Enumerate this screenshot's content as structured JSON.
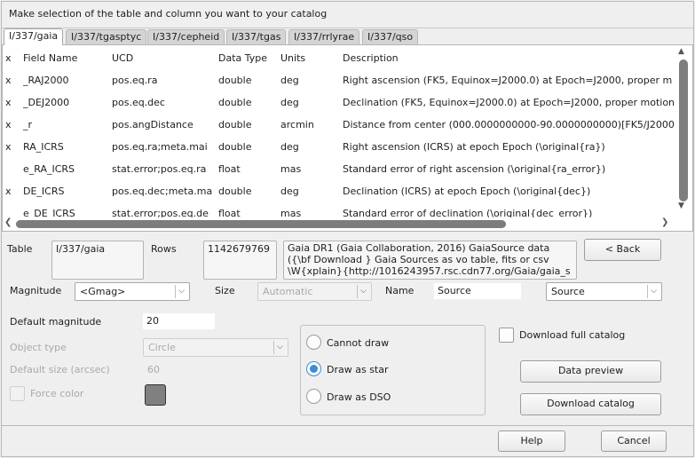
{
  "header": "Make selection of the table and column you want to your catalog",
  "tabs": [
    "I/337/gaia",
    "I/337/tgasptyc",
    "I/337/cepheid",
    "I/337/tgas",
    "I/337/rrlyrae",
    "I/337/qso"
  ],
  "table": {
    "columns": [
      "x",
      "Field Name",
      "UCD",
      "Data Type",
      "Units",
      "Description"
    ],
    "rows": [
      {
        "x": "x",
        "name": "_RAJ2000",
        "ucd": "pos.eq.ra",
        "type": "double",
        "units": "deg",
        "desc": "Right ascension (FK5, Equinox=J2000.0) at Epoch=J2000, proper m"
      },
      {
        "x": "x",
        "name": "_DEJ2000",
        "ucd": "pos.eq.dec",
        "type": "double",
        "units": "deg",
        "desc": "Declination (FK5, Equinox=J2000.0) at Epoch=J2000, proper motion"
      },
      {
        "x": "x",
        "name": "_r",
        "ucd": "pos.angDistance",
        "type": "double",
        "units": "arcmin",
        "desc": "Distance from center (000.0000000000-90.0000000000)[FK5/J2000"
      },
      {
        "x": "x",
        "name": "RA_ICRS",
        "ucd": "pos.eq.ra;meta.mai",
        "type": "double",
        "units": "deg",
        "desc": "Right ascension (ICRS) at epoch Epoch (\\original{ra})"
      },
      {
        "x": "",
        "name": "e_RA_ICRS",
        "ucd": "stat.error;pos.eq.ra",
        "type": "float",
        "units": "mas",
        "desc": "Standard error of right ascension (\\original{ra_error})"
      },
      {
        "x": "x",
        "name": "DE_ICRS",
        "ucd": "pos.eq.dec;meta.ma",
        "type": "double",
        "units": "deg",
        "desc": "Declination (ICRS) at epoch Epoch (\\original{dec})"
      },
      {
        "x": "",
        "name": "e_DE_ICRS",
        "ucd": "stat.error;pos.eq.de",
        "type": "float",
        "units": "mas",
        "desc": "Standard error of declination (\\original{dec_error})"
      }
    ]
  },
  "form": {
    "table_label": "Table",
    "table_value": "I/337/gaia",
    "rows_label": "Rows",
    "rows_value": "1142679769",
    "description": "Gaia DR1 (Gaia Collaboration, 2016) GaiaSource data\n({\\bf Download } Gaia Sources as vo table, fits or csv\n\\W{xplain}{http://1016243957.rsc.cdn77.org/Gaia/gaia_s",
    "back_label": "< Back",
    "magnitude_label": "Magnitude",
    "magnitude_value": "<Gmag>",
    "size_label": "Size",
    "size_value": "Automatic",
    "name_label": "Name",
    "name_value": "Source",
    "name_combo_value": "Source",
    "default_magnitude_label": "Default magnitude",
    "default_magnitude_value": "20",
    "object_type_label": "Object type",
    "object_type_value": "Circle",
    "default_size_label": "Default size (arcsec)",
    "default_size_value": "60",
    "force_color_label": "Force color",
    "force_color_swatch": "#808080",
    "radio_options": [
      "Cannot draw",
      "Draw as star",
      "Draw as DSO"
    ],
    "radio_selected": "Draw as star",
    "download_full_label": "Download full catalog",
    "data_preview_label": "Data preview",
    "download_catalog_label": "Download catalog"
  },
  "footer": {
    "help_label": "Help",
    "cancel_label": "Cancel"
  },
  "colors": {
    "accent": "#3b8ed4",
    "background": "#efefef"
  }
}
